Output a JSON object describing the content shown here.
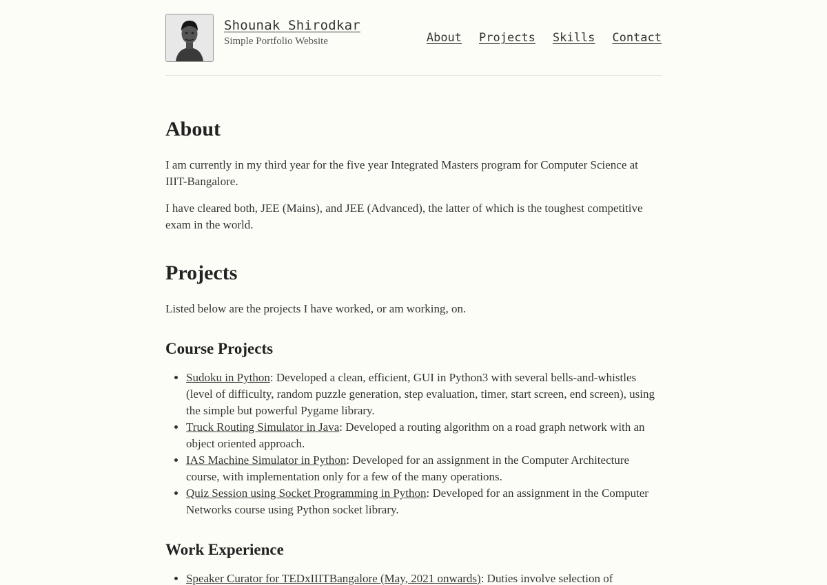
{
  "header": {
    "site_title": "Shounak Shirodkar",
    "tagline": "Simple Portfolio Website",
    "nav": [
      {
        "label": "About"
      },
      {
        "label": "Projects"
      },
      {
        "label": "Skills"
      },
      {
        "label": "Contact"
      }
    ]
  },
  "about": {
    "heading": "About",
    "paragraphs": [
      "I am currently in my third year for the five year Integrated Masters program for Computer Science at IIIT-Bangalore.",
      "I have cleared both, JEE (Mains), and JEE (Advanced), the latter of which is the toughest competitive exam in the world."
    ]
  },
  "projects": {
    "heading": "Projects",
    "intro": "Listed below are the projects I have worked, or am working, on.",
    "course": {
      "heading": "Course Projects",
      "items": [
        {
          "link": "Sudoku in Python",
          "text": ": Developed a clean, efficient, GUI in Python3 with several bells-and-whistles (level of difficulty, random puzzle generation, step evaluation, timer, start screen, end screen), using the simple but powerful Pygame library."
        },
        {
          "link": "Truck Routing Simulator in Java",
          "text": ": Developed a routing algorithm on a road graph network with an object oriented approach."
        },
        {
          "link": "IAS Machine Simulator in Python",
          "text": ": Developed for an assignment in the Computer Architecture course, with implementation only for a few of the many operations."
        },
        {
          "link": "Quiz Session using Socket Programming in Python",
          "text": ": Developed for an assignment in the Computer Networks course using Python socket library."
        }
      ]
    },
    "work": {
      "heading": "Work Experience",
      "items": [
        {
          "link": "Speaker Curator for TEDxIIITBangalore (May, 2021 onwards)",
          "text": ": Duties involve selection of"
        }
      ]
    }
  }
}
